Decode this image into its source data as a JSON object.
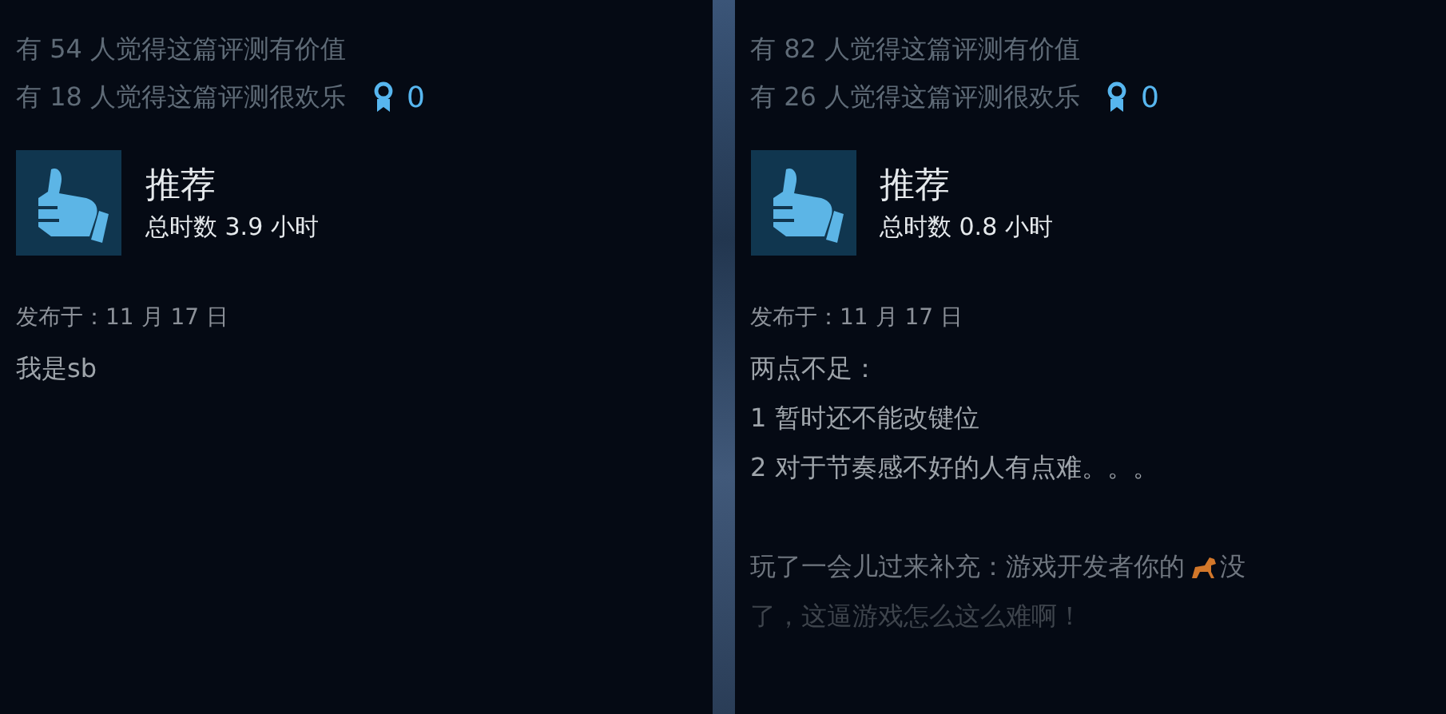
{
  "reviews": [
    {
      "helpful": "有 54 人觉得这篇评测有价值",
      "funny": "有 18 人觉得这篇评测很欢乐",
      "awards": "0",
      "verdict": "推荐",
      "recommended": true,
      "hours": "总时数 3.9 小时",
      "posted": "发布于：11 月 17 日",
      "body": [
        {
          "kind": "text",
          "text": "我是sb"
        }
      ]
    },
    {
      "helpful": "有 82 人觉得这篇评测有价值",
      "funny": "有 26 人觉得这篇评测很欢乐",
      "awards": "0",
      "verdict": "推荐",
      "recommended": true,
      "hours": "总时数 0.8 小时",
      "posted": "发布于：11 月 17 日",
      "body": [
        {
          "kind": "text",
          "text": "两点不足："
        },
        {
          "kind": "text",
          "text": "1 暂时还不能改键位"
        },
        {
          "kind": "text",
          "text": "2 对于节奏感不好的人有点难。。。"
        },
        {
          "kind": "blank"
        },
        {
          "kind": "emoji_text",
          "before": "玩了一会儿过来补充：游戏开发者你的",
          "after": "没"
        },
        {
          "kind": "faded",
          "text": "了，这逼游戏怎么这么难啊！"
        }
      ]
    }
  ]
}
